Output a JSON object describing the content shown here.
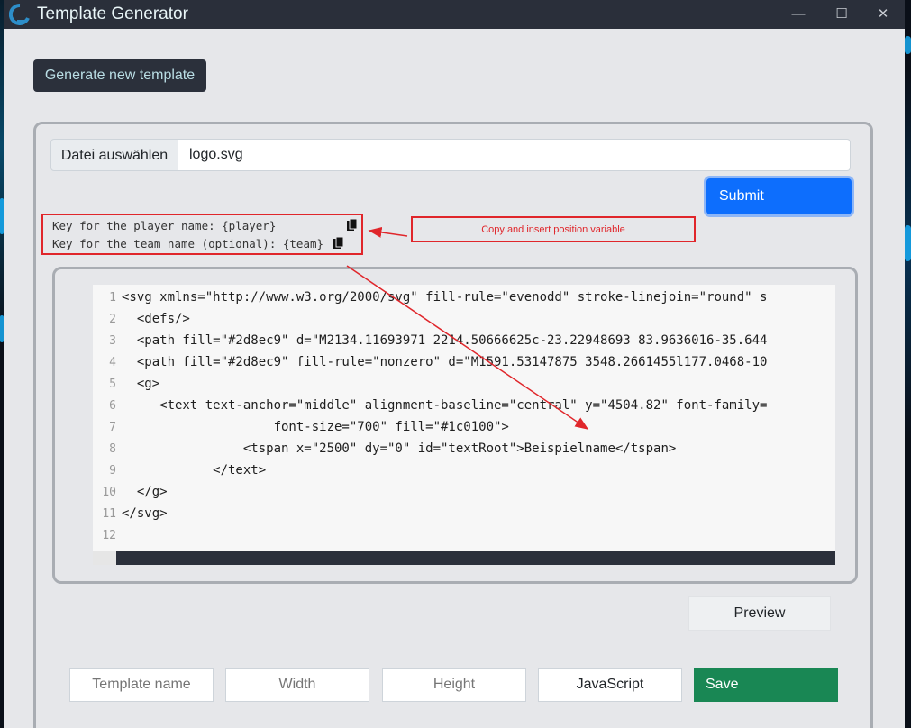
{
  "window": {
    "title": "Template Generator",
    "minimize": "—",
    "maximize": "☐",
    "close": "✕"
  },
  "toolbar": {
    "generate_label": "Generate new template"
  },
  "file": {
    "choose_label": "Datei auswählen",
    "selected_file": "logo.svg"
  },
  "submit_label": "Submit",
  "keys": {
    "player_label": "Key for the player name:         {player}",
    "team_label": "Key for the team name (optional): {team}"
  },
  "annotation": "Copy and insert position variable",
  "editor": {
    "line_numbers": [
      "1",
      "2",
      "3",
      "4",
      "5",
      "6",
      "7",
      "8",
      "9",
      "10",
      "11",
      "12"
    ],
    "lines": [
      "<svg xmlns=\"http://www.w3.org/2000/svg\" fill-rule=\"evenodd\" stroke-linejoin=\"round\" s",
      "  <defs/>",
      "  <path fill=\"#2d8ec9\" d=\"M2134.11693971 2214.50666625c-23.22948693 83.9636016-35.644",
      "  <path fill=\"#2d8ec9\" fill-rule=\"nonzero\" d=\"M1591.53147875 3548.2661455l177.0468-10",
      "  <g>",
      "     <text text-anchor=\"middle\" alignment-baseline=\"central\" y=\"4504.82\" font-family=",
      "                    font-size=\"700\" fill=\"#1c0100\">",
      "                <tspan x=\"2500\" dy=\"0\" id=\"textRoot\">Beispielname</tspan>",
      "            </text>",
      "  </g>",
      "</svg>",
      ""
    ]
  },
  "preview_label": "Preview",
  "form": {
    "template_name_placeholder": "Template name",
    "width_placeholder": "Width",
    "height_placeholder": "Height",
    "javascript_label": "JavaScript",
    "save_label": "Save"
  },
  "colors": {
    "accent": "#0d6efd",
    "save": "#198754",
    "annotation": "#e0262b",
    "titlebar": "#2a2f3a"
  }
}
